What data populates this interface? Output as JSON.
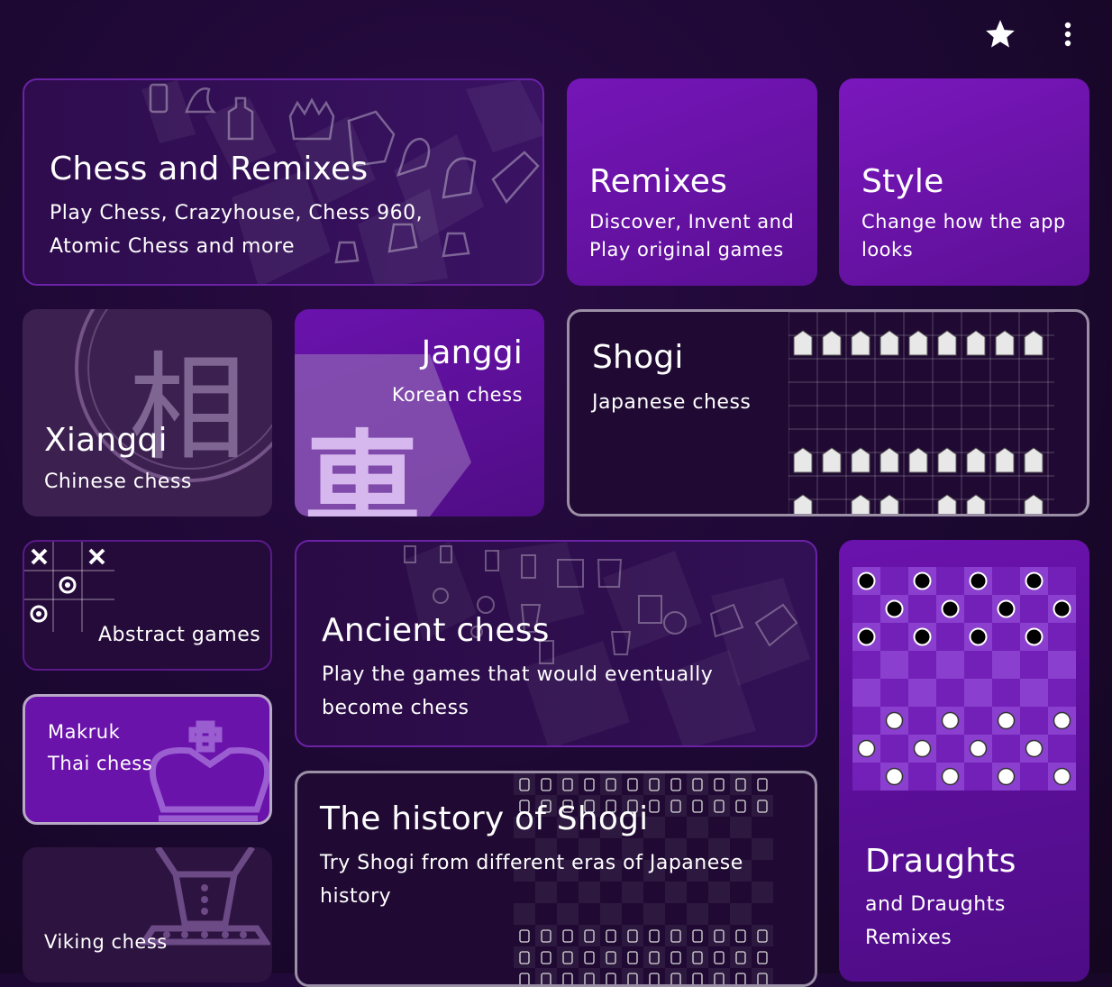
{
  "toolbar": {
    "favorite_icon": "star-icon",
    "menu_icon": "more-vert-icon"
  },
  "cards": {
    "chess": {
      "title": "Chess and Remixes",
      "subtitle": "Play Chess, Crazyhouse, Chess 960, Atomic Chess and more"
    },
    "remixes": {
      "title": "Remixes",
      "subtitle": "Discover, Invent and Play original games"
    },
    "style": {
      "title": "Style",
      "subtitle": "Change how the app looks"
    },
    "xiangqi": {
      "title": "Xiangqi",
      "subtitle": "Chinese chess",
      "glyph": "相"
    },
    "janggi": {
      "title": "Janggi",
      "subtitle": "Korean chess",
      "glyph": "車"
    },
    "shogi": {
      "title": "Shogi",
      "subtitle": "Japanese chess"
    },
    "abstract": {
      "title": "Abstract games"
    },
    "ancient": {
      "title": "Ancient chess",
      "subtitle": "Play the games that would eventually become chess"
    },
    "draughts": {
      "title": "Draughts",
      "subtitle": "and Draughts Remixes"
    },
    "makruk": {
      "title": "Makruk",
      "subtitle": "Thai chess"
    },
    "history": {
      "title": "The history of Shogi",
      "subtitle": "Try Shogi from different eras of Japanese history"
    },
    "viking": {
      "title": "Viking chess"
    }
  },
  "colors": {
    "accent": "#7a17bd",
    "background": "#1c0832"
  }
}
